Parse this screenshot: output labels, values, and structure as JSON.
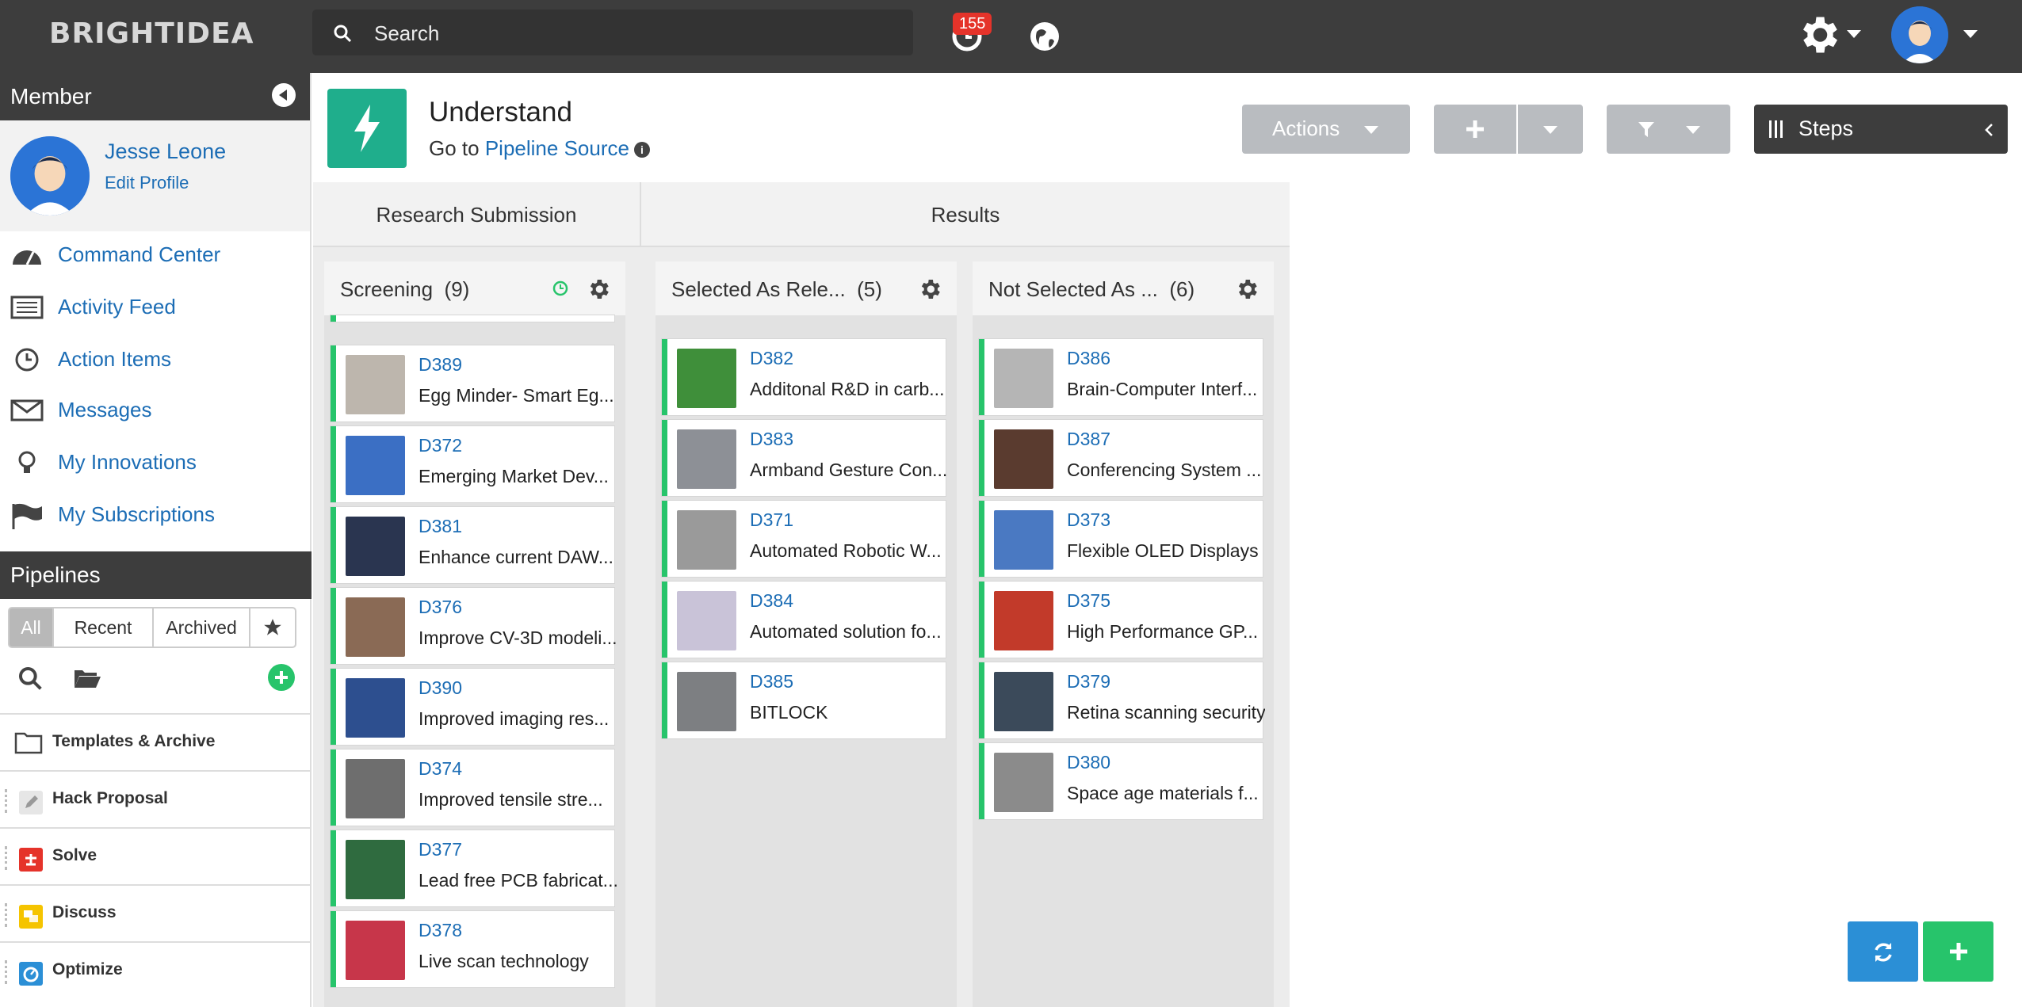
{
  "topbar": {
    "logo": "BRIGHTIDEA",
    "search_placeholder": "Search",
    "notification_count": "155"
  },
  "sidebar": {
    "member_heading": "Member",
    "user_name": "Jesse Leone",
    "edit_profile": "Edit Profile",
    "nav": [
      {
        "label": "Command Center",
        "icon": "dashboard-icon"
      },
      {
        "label": "Activity Feed",
        "icon": "list-icon"
      },
      {
        "label": "Action Items",
        "icon": "clock-icon"
      },
      {
        "label": "Messages",
        "icon": "envelope-icon"
      },
      {
        "label": "My Innovations",
        "icon": "lightbulb-icon"
      },
      {
        "label": "My Subscriptions",
        "icon": "flag-icon"
      }
    ],
    "pipelines_heading": "Pipelines",
    "filter_tabs": [
      "All",
      "Recent",
      "Archived"
    ],
    "templates_label": "Templates & Archive",
    "pipelines": [
      {
        "label": "Hack Proposal",
        "color": "#e6e6e6"
      },
      {
        "label": "Solve",
        "color": "#e5332a"
      },
      {
        "label": "Discuss",
        "color": "#f5c400"
      },
      {
        "label": "Optimize",
        "color": "#2b8fd6"
      }
    ]
  },
  "header": {
    "stage_title": "Understand",
    "goto_prefix": "Go to",
    "goto_link": "Pipeline Source",
    "actions_label": "Actions",
    "steps_label": "Steps"
  },
  "board": {
    "columns": [
      "Research Submission",
      "Results"
    ],
    "lanes": [
      {
        "title": "Screening",
        "count": "(9)",
        "cards": [
          {
            "id": "D389",
            "title": "Egg Minder- Smart Eg...",
            "thumb": "#bdb6ad"
          },
          {
            "id": "D372",
            "title": "Emerging Market Dev...",
            "thumb": "#3b6fc4"
          },
          {
            "id": "D381",
            "title": "Enhance current DAW...",
            "thumb": "#2a3550"
          },
          {
            "id": "D376",
            "title": "Improve CV-3D modeli...",
            "thumb": "#8a6a55"
          },
          {
            "id": "D390",
            "title": "Improved imaging res...",
            "thumb": "#2d4f8f"
          },
          {
            "id": "D374",
            "title": "Improved tensile stre...",
            "thumb": "#6e6e6e"
          },
          {
            "id": "D377",
            "title": "Lead free PCB fabricat...",
            "thumb": "#2f6b3f"
          },
          {
            "id": "D378",
            "title": "Live scan technology",
            "thumb": "#c7364a"
          }
        ]
      },
      {
        "title": "Selected As Rele...",
        "count": "(5)",
        "cards": [
          {
            "id": "D382",
            "title": "Additonal R&D in carb...",
            "thumb": "#3f8f3a"
          },
          {
            "id": "D383",
            "title": "Armband Gesture Con...",
            "thumb": "#8d9096"
          },
          {
            "id": "D371",
            "title": "Automated Robotic W...",
            "thumb": "#9a9a9a"
          },
          {
            "id": "D384",
            "title": "Automated solution fo...",
            "thumb": "#c9c3d8"
          },
          {
            "id": "D385",
            "title": "BITLOCK",
            "thumb": "#7d7f82"
          }
        ]
      },
      {
        "title": "Not Selected As ...",
        "count": "(6)",
        "cards": [
          {
            "id": "D386",
            "title": "Brain-Computer Interf...",
            "thumb": "#b5b5b5"
          },
          {
            "id": "D387",
            "title": "Conferencing System ...",
            "thumb": "#5a3b2f"
          },
          {
            "id": "D373",
            "title": "Flexible OLED Displays",
            "thumb": "#4a79c2"
          },
          {
            "id": "D375",
            "title": "High Performance GP...",
            "thumb": "#c23a2a"
          },
          {
            "id": "D379",
            "title": "Retina scanning security",
            "thumb": "#3b4a5a"
          },
          {
            "id": "D380",
            "title": "Space age materials f...",
            "thumb": "#8b8b8b"
          }
        ]
      }
    ]
  },
  "colors": {
    "accent_green": "#27c46b",
    "stage_teal": "#1fae8c",
    "link_blue": "#1c6db5",
    "dark_bar": "#3d3d3d"
  }
}
